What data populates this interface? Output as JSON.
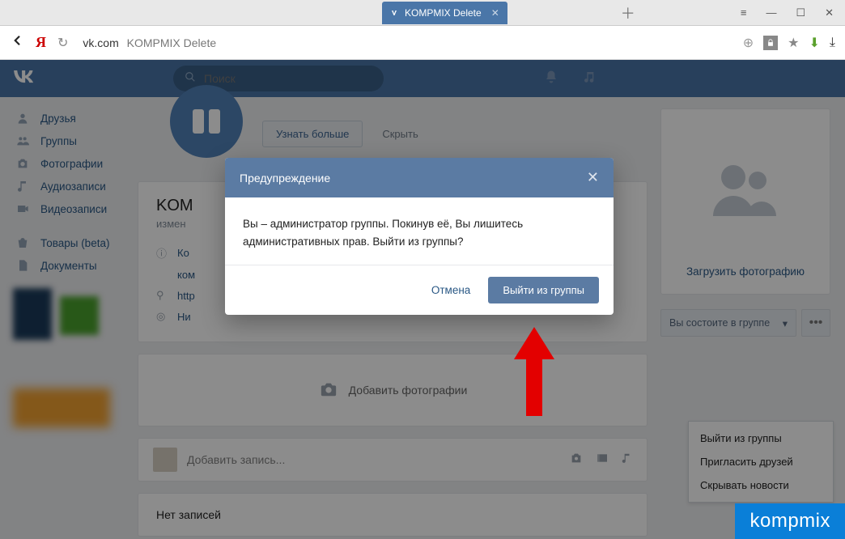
{
  "browser": {
    "tab_title": "KOMPMIX Delete",
    "url_host": "vk.com",
    "url_path": "KOMPMIX Delete"
  },
  "vk_header": {
    "search_placeholder": "Поиск"
  },
  "sidebar": {
    "items": [
      {
        "label": "Друзья"
      },
      {
        "label": "Группы"
      },
      {
        "label": "Фотографии"
      },
      {
        "label": "Аудиозаписи"
      },
      {
        "label": "Видеозаписи"
      }
    ],
    "items2": [
      {
        "label": "Товары (beta)"
      },
      {
        "label": "Документы"
      }
    ]
  },
  "promo": {
    "button": "Узнать больше",
    "hide": "Скрыть"
  },
  "group": {
    "title_visible": "KOM",
    "subtitle_visible": "измен",
    "info_desc_visible": "Ко",
    "info_desc_visible2": "ком",
    "info_link_visible": "http",
    "info_loc_visible": "Ни"
  },
  "add_photo": "Добавить фотографии",
  "add_post_placeholder": "Добавить запись...",
  "no_posts": "Нет записей",
  "right": {
    "upload": "Загрузить фотографию",
    "member_btn": "Вы состоите в группе",
    "menu": [
      "Выйти из группы",
      "Пригласить друзей",
      "Скрывать новости"
    ]
  },
  "modal": {
    "title": "Предупреждение",
    "body": "Вы – администратор группы. Покинув её, Вы лишитесь административных прав. Выйти из группы?",
    "cancel": "Отмена",
    "confirm": "Выйти из группы"
  },
  "watermark": "kompmix"
}
